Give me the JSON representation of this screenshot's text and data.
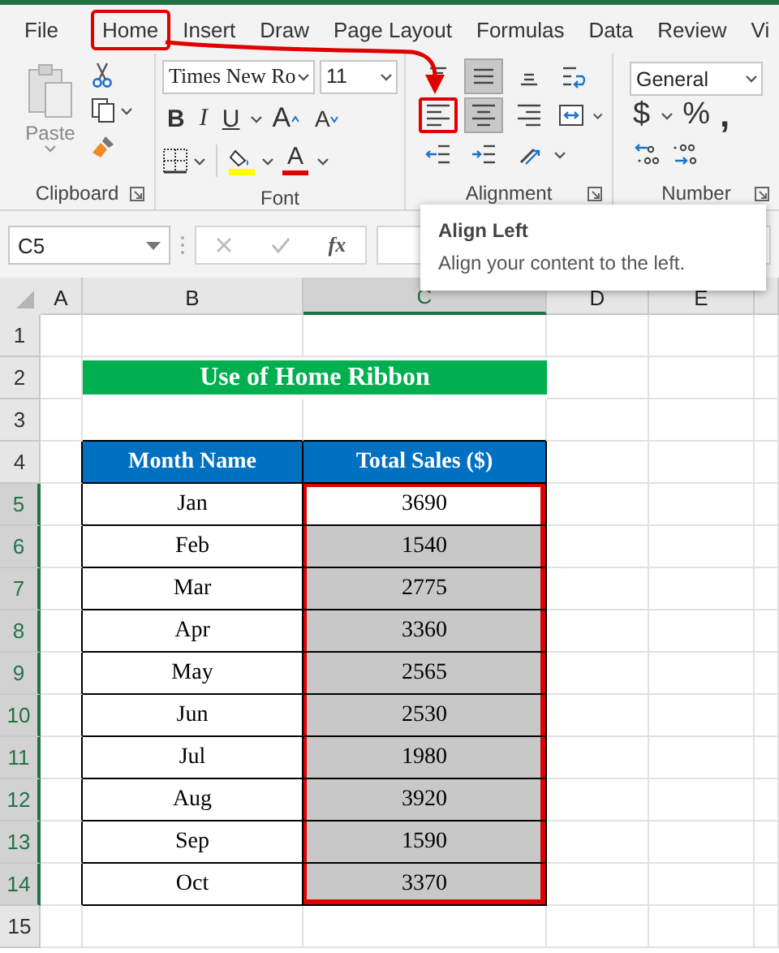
{
  "menu_tabs": [
    {
      "label": "File",
      "selected": false
    },
    {
      "label": "Home",
      "selected": true
    },
    {
      "label": "Insert",
      "selected": false
    },
    {
      "label": "Draw",
      "selected": false
    },
    {
      "label": "Page Layout",
      "selected": false
    },
    {
      "label": "Formulas",
      "selected": false
    },
    {
      "label": "Data",
      "selected": false
    },
    {
      "label": "Review",
      "selected": false
    },
    {
      "label": "Vi",
      "selected": false
    }
  ],
  "clipboard": {
    "paste_label": "Paste",
    "label": "Clipboard"
  },
  "font": {
    "name": "Times New Ro",
    "size": "11",
    "label": "Font",
    "font_color_glyph": "A",
    "buttons": [
      {
        "kind": "bold",
        "glyph": "B"
      },
      {
        "kind": "italic",
        "glyph": "I"
      },
      {
        "kind": "underline",
        "glyph": "U"
      },
      {
        "kind": "grow",
        "glyph": "A"
      },
      {
        "kind": "shrink",
        "glyph": "A"
      }
    ]
  },
  "alignment": {
    "label": "Alignment",
    "buttons": [
      {
        "kind": "top",
        "selected": false,
        "highlighted": false
      },
      {
        "kind": "middle",
        "selected": true,
        "highlighted": false
      },
      {
        "kind": "bottom",
        "selected": false,
        "highlighted": false
      },
      {
        "kind": "wrap",
        "selected": false,
        "highlighted": false
      },
      {
        "kind": "left",
        "selected": false,
        "highlighted": true
      },
      {
        "kind": "center",
        "selected": true,
        "highlighted": false
      },
      {
        "kind": "right",
        "selected": false,
        "highlighted": false
      },
      {
        "kind": "merge",
        "selected": false,
        "highlighted": false
      },
      {
        "kind": "outdent",
        "selected": false,
        "highlighted": false
      },
      {
        "kind": "indent",
        "selected": false,
        "highlighted": false
      },
      {
        "kind": "orientation",
        "selected": false,
        "highlighted": false
      }
    ]
  },
  "number": {
    "label": "Number",
    "format": "General",
    "symbols": [
      "$",
      "%",
      ","
    ]
  },
  "formula_bar": {
    "name_box": "C5",
    "fx": "fx"
  },
  "tooltip": {
    "title": "Align Left",
    "text": "Align your content to the left."
  },
  "columns": [
    {
      "label": "A",
      "selected": false
    },
    {
      "label": "B",
      "selected": false
    },
    {
      "label": "C",
      "selected": true
    },
    {
      "label": "D",
      "selected": false
    },
    {
      "label": "E",
      "selected": false
    }
  ],
  "row_numbers": [
    {
      "label": "1",
      "selected": false
    },
    {
      "label": "2",
      "selected": false
    },
    {
      "label": "3",
      "selected": false
    },
    {
      "label": "4",
      "selected": false
    },
    {
      "label": "5",
      "selected": true
    },
    {
      "label": "6",
      "selected": true
    },
    {
      "label": "7",
      "selected": true
    },
    {
      "label": "8",
      "selected": true
    },
    {
      "label": "9",
      "selected": true
    },
    {
      "label": "10",
      "selected": true
    },
    {
      "label": "11",
      "selected": true
    },
    {
      "label": "12",
      "selected": true
    },
    {
      "label": "13",
      "selected": true
    },
    {
      "label": "14",
      "selected": true
    },
    {
      "label": "15",
      "selected": false
    }
  ],
  "sheet": {
    "title": "Use of Home Ribbon",
    "headers": [
      "Month Name",
      "Total Sales ($)"
    ],
    "rows": [
      {
        "month": "Jan",
        "sales": "3690",
        "selected": true,
        "active": true
      },
      {
        "month": "Feb",
        "sales": "1540",
        "selected": true,
        "active": false
      },
      {
        "month": "Mar",
        "sales": "2775",
        "selected": true,
        "active": false
      },
      {
        "month": "Apr",
        "sales": "3360",
        "selected": true,
        "active": false
      },
      {
        "month": "May",
        "sales": "2565",
        "selected": true,
        "active": false
      },
      {
        "month": "Jun",
        "sales": "2530",
        "selected": true,
        "active": false
      },
      {
        "month": "Jul",
        "sales": "1980",
        "selected": true,
        "active": false
      },
      {
        "month": "Aug",
        "sales": "3920",
        "selected": true,
        "active": false
      },
      {
        "month": "Sep",
        "sales": "1590",
        "selected": true,
        "active": false
      },
      {
        "month": "Oct",
        "sales": "3370",
        "selected": true,
        "active": false
      }
    ]
  }
}
